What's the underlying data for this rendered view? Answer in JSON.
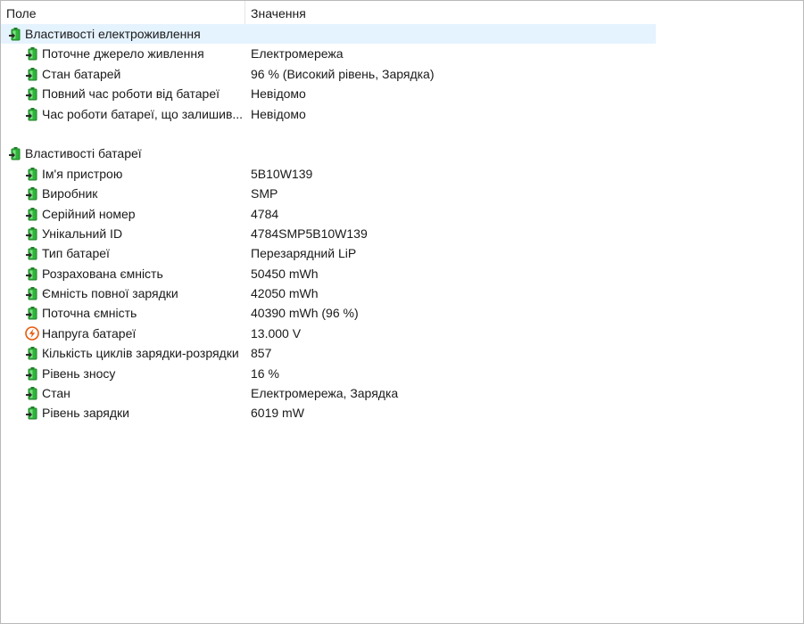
{
  "header": {
    "field": "Поле",
    "value": "Значення"
  },
  "colors": {
    "battery_green": "#2fb53a",
    "bolt_orange": "#e8590c",
    "selected_row": "#e5f3ff"
  },
  "groups": [
    {
      "title": "Властивості електроживлення",
      "icon": "battery-icon",
      "rows": [
        {
          "field": "Поточне джерело живлення",
          "value": "Електромережа",
          "icon": "battery-icon"
        },
        {
          "field": "Стан батарей",
          "value": "96 % (Високий рівень, Зарядка)",
          "icon": "battery-icon"
        },
        {
          "field": "Повний час роботи від батареї",
          "value": "Невідомо",
          "icon": "battery-icon"
        },
        {
          "field": "Час роботи батареї, що залишив...",
          "value": "Невідомо",
          "icon": "battery-icon"
        }
      ]
    },
    {
      "title": "Властивості батареї",
      "icon": "battery-icon",
      "rows": [
        {
          "field": "Ім'я пристрою",
          "value": "5B10W139",
          "icon": "battery-icon"
        },
        {
          "field": "Виробник",
          "value": "SMP",
          "icon": "battery-icon"
        },
        {
          "field": "Серійний номер",
          "value": "4784",
          "icon": "battery-icon"
        },
        {
          "field": "Унікальний ID",
          "value": "4784SMP5B10W139",
          "icon": "battery-icon"
        },
        {
          "field": "Тип батареї",
          "value": "Перезарядний LiP",
          "icon": "battery-icon"
        },
        {
          "field": "Розрахована ємність",
          "value": "50450 mWh",
          "icon": "battery-icon"
        },
        {
          "field": "Ємність повної зарядки",
          "value": "42050 mWh",
          "icon": "battery-icon"
        },
        {
          "field": "Поточна ємність",
          "value": "40390 mWh  (96 %)",
          "icon": "battery-icon"
        },
        {
          "field": "Напруга батареї",
          "value": "13.000 V",
          "icon": "voltage-icon"
        },
        {
          "field": "Кількість циклів зарядки-розрядки",
          "value": "857",
          "icon": "battery-icon"
        },
        {
          "field": "Рівень зносу",
          "value": "16 %",
          "icon": "battery-icon"
        },
        {
          "field": "Стан",
          "value": "Електромережа, Зарядка",
          "icon": "battery-icon"
        },
        {
          "field": "Рівень зарядки",
          "value": "6019 mW",
          "icon": "battery-icon"
        }
      ]
    }
  ]
}
